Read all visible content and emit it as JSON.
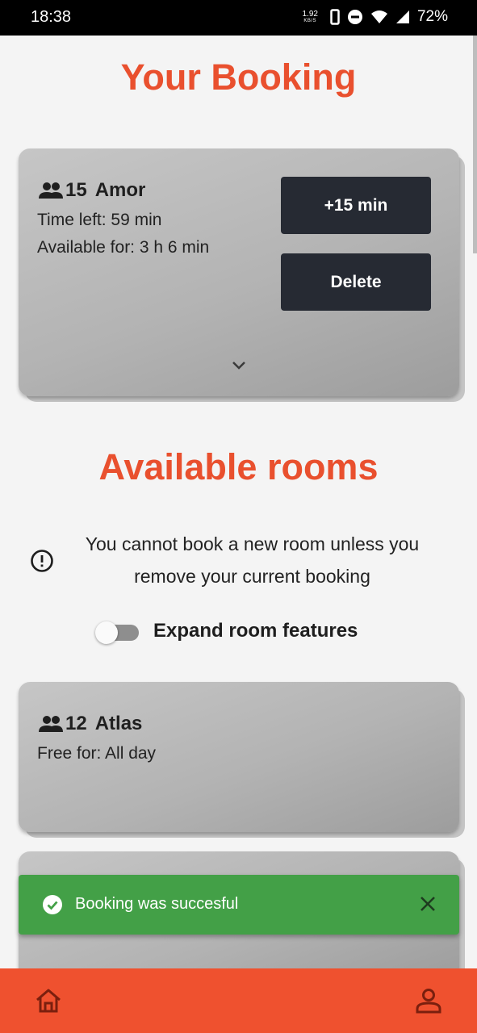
{
  "status_bar": {
    "time": "18:38",
    "speed_value": "1.92",
    "speed_unit": "KB/S",
    "battery": "72%"
  },
  "booking_section": {
    "title": "Your Booking",
    "booking": {
      "capacity": "15",
      "room_name": "Amor",
      "time_left": "Time left: 59 min",
      "available_for": "Available for: 3 h 6 min",
      "extend_label": "+15 min",
      "delete_label": "Delete"
    }
  },
  "available_section": {
    "title": "Available rooms",
    "notice": "You cannot book a new room unless you remove your current booking",
    "toggle_label": "Expand room features",
    "toggle_on": false,
    "rooms": [
      {
        "capacity": "12",
        "room_name": "Atlas",
        "free_for": "Free for: All day"
      }
    ]
  },
  "snackbar": {
    "message": "Booking was succesful",
    "color": "#43a047"
  },
  "bottom_nav": {
    "items": [
      "home-icon",
      "profile-icon"
    ],
    "color": "#ef512f"
  },
  "colors": {
    "accent": "#e9502e",
    "button": "#262a33"
  }
}
